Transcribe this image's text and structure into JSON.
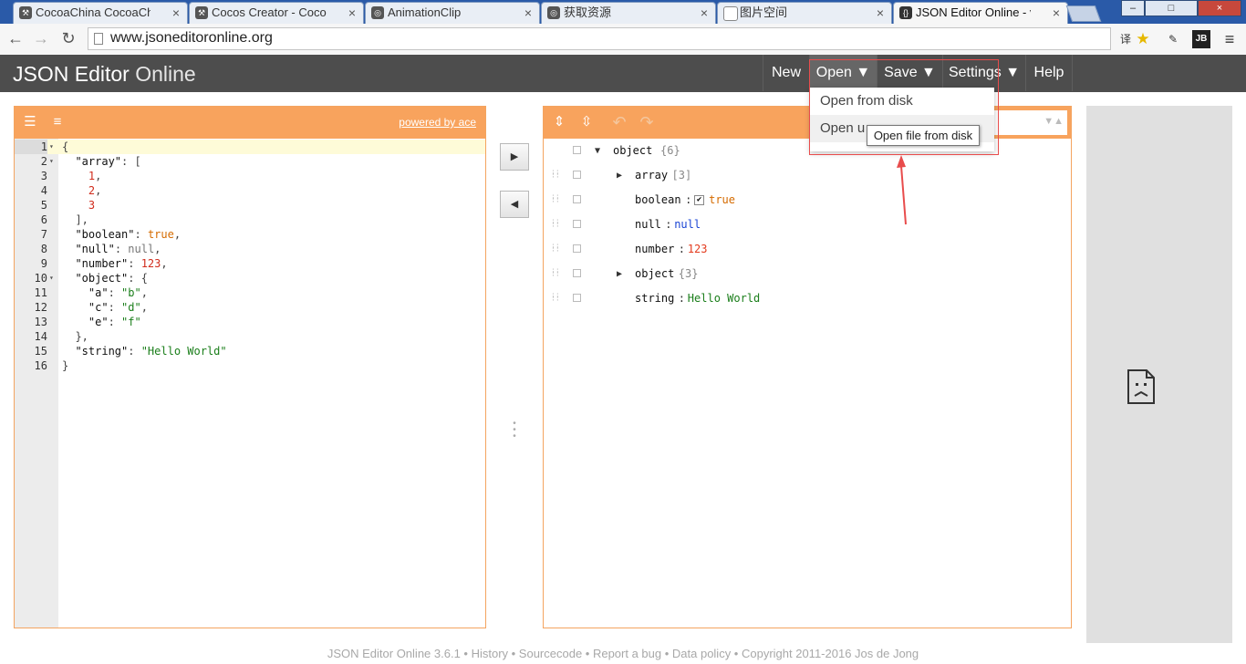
{
  "browser": {
    "tabs": [
      {
        "title": "CocoaChina CocoaChina",
        "active": false
      },
      {
        "title": "Cocos Creator - CocoaC",
        "active": false
      },
      {
        "title": "AnimationClip",
        "active": false
      },
      {
        "title": "获取资源",
        "active": false
      },
      {
        "title": "图片空间",
        "active": false
      },
      {
        "title": "JSON Editor Online - vie",
        "active": true
      }
    ],
    "favicon_text": "{}",
    "close_glyph": "×",
    "url": "www.jsoneditoronline.org",
    "window_buttons": {
      "minimize": "–",
      "maximize": "□",
      "close": "×"
    },
    "toolbar_icons": {
      "translate": "译",
      "bookmark": "★",
      "extension": "JB",
      "menu": "≡"
    }
  },
  "app": {
    "title_bold": "JSON Editor",
    "title_light": "Online",
    "menu": {
      "new": "New",
      "open": "Open ▼",
      "save": "Save ▼",
      "settings": "Settings ▼",
      "help": "Help"
    },
    "open_dropdown": {
      "items": [
        "Open from disk",
        "Open url"
      ],
      "visible_second": "Open u",
      "tooltip": "Open file from disk"
    }
  },
  "code_editor": {
    "powered_by": "powered by ace",
    "icons": {
      "format": "format-icon",
      "compact": "compact-icon"
    },
    "lines": [
      {
        "n": "1",
        "fold": "▾",
        "tokens": [
          [
            "p",
            "{"
          ]
        ]
      },
      {
        "n": "2",
        "fold": "▾",
        "tokens": [
          [
            "p",
            "  "
          ],
          [
            "k",
            "\"array\""
          ],
          [
            "p",
            ": ["
          ]
        ]
      },
      {
        "n": "3",
        "fold": "",
        "tokens": [
          [
            "p",
            "    "
          ],
          [
            "num",
            "1"
          ],
          [
            "p",
            ","
          ]
        ]
      },
      {
        "n": "4",
        "fold": "",
        "tokens": [
          [
            "p",
            "    "
          ],
          [
            "num",
            "2"
          ],
          [
            "p",
            ","
          ]
        ]
      },
      {
        "n": "5",
        "fold": "",
        "tokens": [
          [
            "p",
            "    "
          ],
          [
            "num",
            "3"
          ]
        ]
      },
      {
        "n": "6",
        "fold": "",
        "tokens": [
          [
            "p",
            "  ],"
          ]
        ]
      },
      {
        "n": "7",
        "fold": "",
        "tokens": [
          [
            "p",
            "  "
          ],
          [
            "k",
            "\"boolean\""
          ],
          [
            "p",
            ": "
          ],
          [
            "bool",
            "true"
          ],
          [
            "p",
            ","
          ]
        ]
      },
      {
        "n": "8",
        "fold": "",
        "tokens": [
          [
            "p",
            "  "
          ],
          [
            "k",
            "\"null\""
          ],
          [
            "p",
            ": "
          ],
          [
            "null",
            "null"
          ],
          [
            "p",
            ","
          ]
        ]
      },
      {
        "n": "9",
        "fold": "",
        "tokens": [
          [
            "p",
            "  "
          ],
          [
            "k",
            "\"number\""
          ],
          [
            "p",
            ": "
          ],
          [
            "num",
            "123"
          ],
          [
            "p",
            ","
          ]
        ]
      },
      {
        "n": "10",
        "fold": "▾",
        "tokens": [
          [
            "p",
            "  "
          ],
          [
            "k",
            "\"object\""
          ],
          [
            "p",
            ": {"
          ]
        ]
      },
      {
        "n": "11",
        "fold": "",
        "tokens": [
          [
            "p",
            "    "
          ],
          [
            "k",
            "\"a\""
          ],
          [
            "p",
            ": "
          ],
          [
            "str",
            "\"b\""
          ],
          [
            "p",
            ","
          ]
        ]
      },
      {
        "n": "12",
        "fold": "",
        "tokens": [
          [
            "p",
            "    "
          ],
          [
            "k",
            "\"c\""
          ],
          [
            "p",
            ": "
          ],
          [
            "str",
            "\"d\""
          ],
          [
            "p",
            ","
          ]
        ]
      },
      {
        "n": "13",
        "fold": "",
        "tokens": [
          [
            "p",
            "    "
          ],
          [
            "k",
            "\"e\""
          ],
          [
            "p",
            ": "
          ],
          [
            "str",
            "\"f\""
          ]
        ]
      },
      {
        "n": "14",
        "fold": "",
        "tokens": [
          [
            "p",
            "  },"
          ]
        ]
      },
      {
        "n": "15",
        "fold": "",
        "tokens": [
          [
            "p",
            "  "
          ],
          [
            "k",
            "\"string\""
          ],
          [
            "p",
            ": "
          ],
          [
            "str",
            "\"Hello World\""
          ]
        ]
      },
      {
        "n": "16",
        "fold": "",
        "tokens": [
          [
            "p",
            "}"
          ]
        ]
      }
    ]
  },
  "transfer": {
    "to_tree": "▶",
    "to_code": "◀"
  },
  "tree_editor": {
    "icons": {
      "expand_all": "expand-all-icon",
      "collapse_all": "collapse-all-icon",
      "undo": "undo-icon",
      "redo": "redo-icon"
    },
    "search_arrows": "▼▲",
    "root": {
      "key": "object",
      "count": "{6}"
    },
    "nodes": [
      {
        "key": "array",
        "colon": "",
        "value": "[3]",
        "type": "count",
        "expandable": true
      },
      {
        "key": "boolean",
        "colon": ":",
        "value": "true",
        "type": "bool",
        "checkbox": true
      },
      {
        "key": "null",
        "colon": ":",
        "value": "null",
        "type": "null"
      },
      {
        "key": "number",
        "colon": ":",
        "value": "123",
        "type": "num"
      },
      {
        "key": "object",
        "colon": "",
        "value": "{3}",
        "type": "count",
        "expandable": true
      },
      {
        "key": "string",
        "colon": ":",
        "value": "Hello World",
        "type": "str"
      }
    ]
  },
  "footer": {
    "text": "JSON Editor Online 3.6.1 • History • Sourcecode • Report a bug • Data policy • Copyright 2011-2016 Jos de Jong"
  },
  "colors": {
    "accent": "#f8a35d",
    "header": "#4d4d4d",
    "annotation": "#e84c4c"
  }
}
